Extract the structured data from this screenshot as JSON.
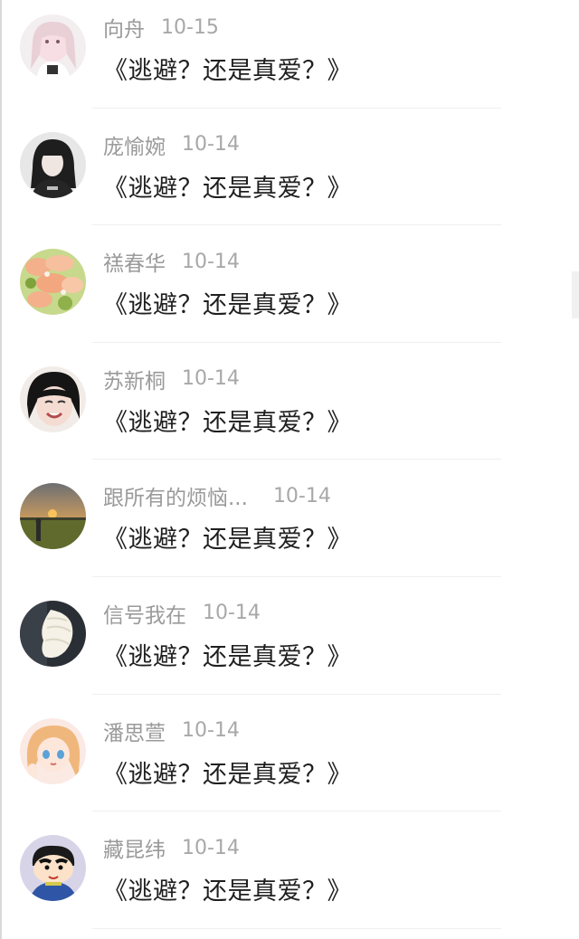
{
  "comments": [
    {
      "name": "向舟",
      "date": "10-15",
      "text": "《逃避？还是真爱？》",
      "avatar": "avatar-girl-pink-icon"
    },
    {
      "name": "庞愉婉",
      "date": "10-14",
      "text": "《逃避？还是真爱？》",
      "avatar": "avatar-girl-dark-icon"
    },
    {
      "name": "禚春华",
      "date": "10-14",
      "text": "《逃避？还是真爱？》",
      "avatar": "avatar-food-icon"
    },
    {
      "name": "苏新桐",
      "date": "10-14",
      "text": "《逃避？还是真爱？》",
      "avatar": "avatar-smiling-girl-icon"
    },
    {
      "name": "跟所有的烦恼...",
      "date": "10-14",
      "text": "《逃避？还是真爱？》",
      "avatar": "avatar-sunset-field-icon"
    },
    {
      "name": "信号我在",
      "date": "10-14",
      "text": "《逃避？还是真爱？》",
      "avatar": "avatar-ice-cream-icon"
    },
    {
      "name": "潘思萱",
      "date": "10-14",
      "text": "《逃避？还是真爱？》",
      "avatar": "avatar-anime-girl-icon"
    },
    {
      "name": "藏昆纬",
      "date": "10-14",
      "text": "《逃避？还是真爱？》",
      "avatar": "avatar-cartoon-boy-icon"
    }
  ],
  "colors": {
    "name": "#9a9a9a",
    "date": "#a8a8a8",
    "text": "#1f1f1f",
    "divider": "#efefef"
  }
}
